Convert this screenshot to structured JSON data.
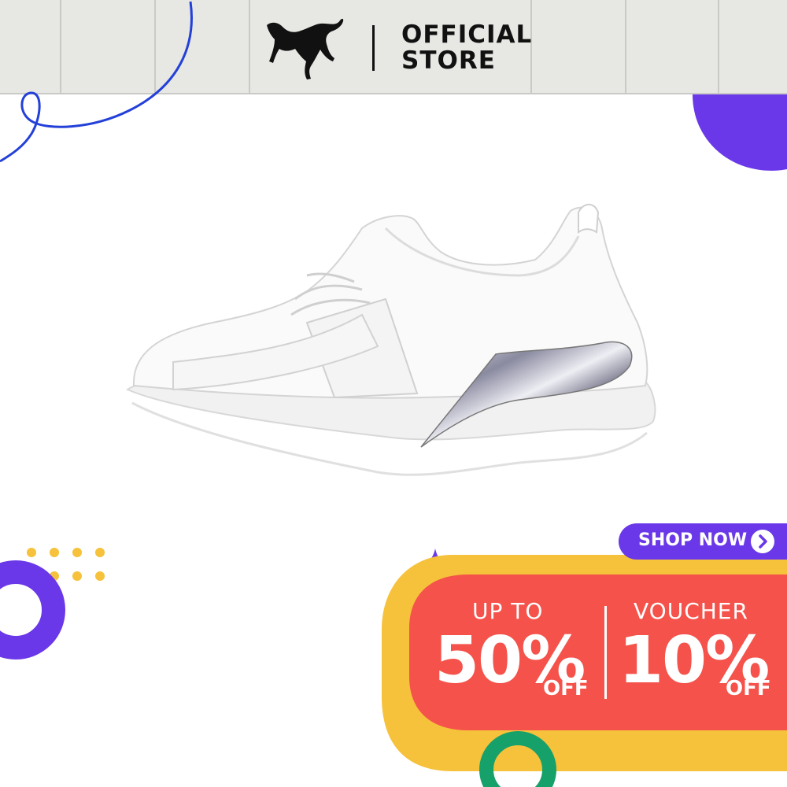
{
  "header": {
    "brand_icon": "puma-cat-logo",
    "store_line1": "OFFICIAL",
    "store_line2": "STORE"
  },
  "product": {
    "image": "white-sneaker-with-silver-heel"
  },
  "promo": {
    "shop_label": "SHOP NOW",
    "shop_icon": "chevron-right-icon",
    "left_prefix": "UP TO",
    "left_value": "50%",
    "left_suffix": "OFF",
    "right_prefix": "VOUCHER",
    "right_value": "10%",
    "right_suffix": "OFF"
  },
  "colors": {
    "header_bg": "#e7e7e3",
    "purple": "#6a38e8",
    "red": "#f4524a",
    "yellow": "#f6c13b",
    "green": "#16a06a",
    "blue_line": "#2340d8"
  }
}
